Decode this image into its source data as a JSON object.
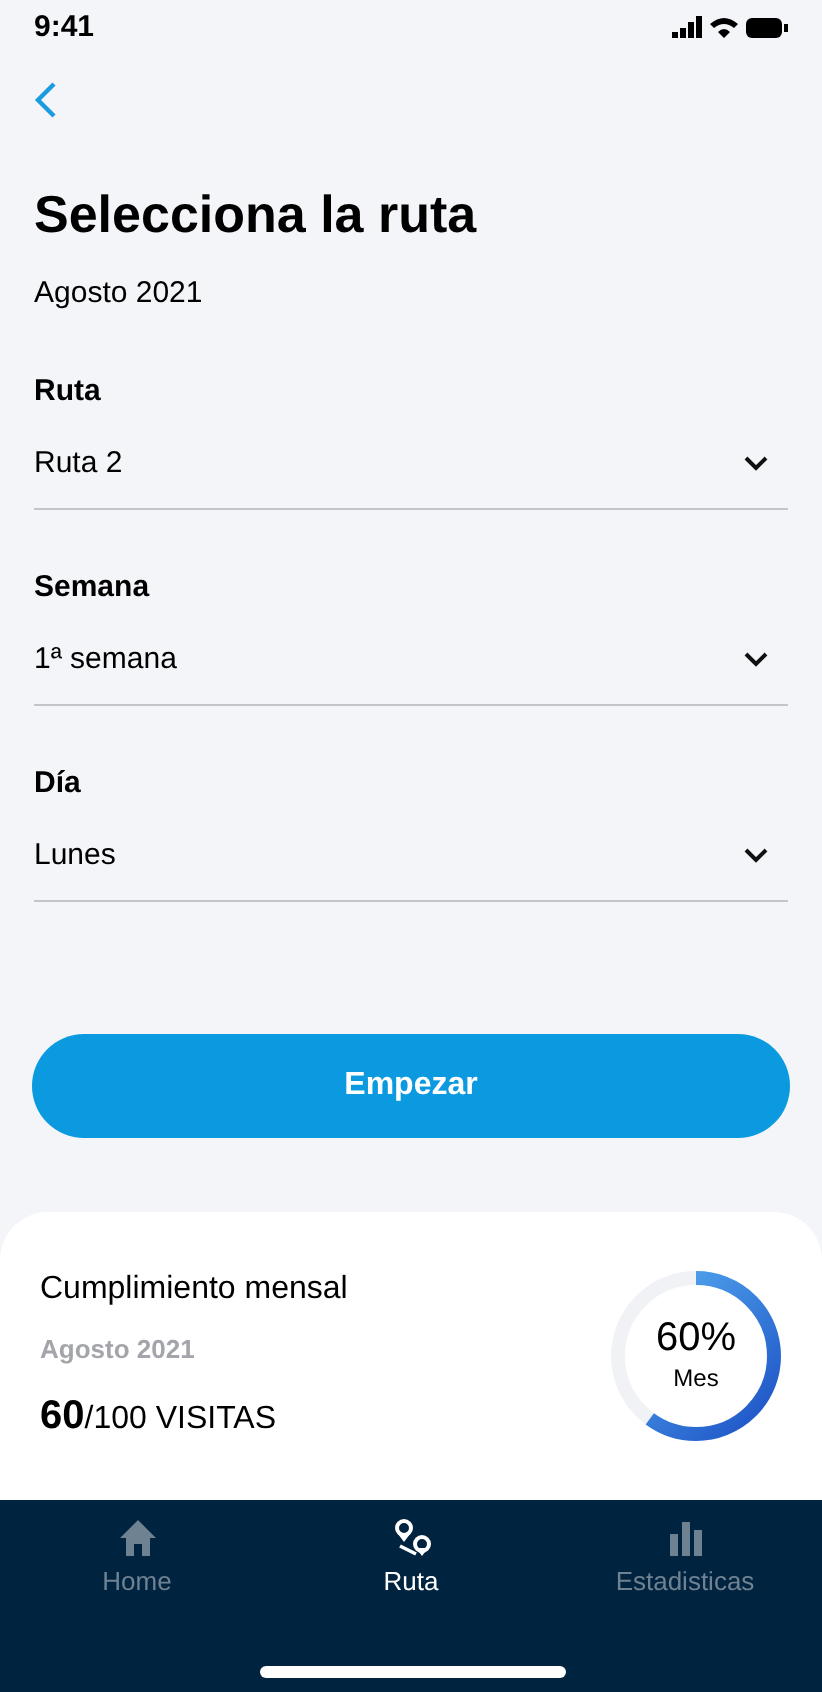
{
  "status_bar": {
    "time": "9:41"
  },
  "title": "Selecciona la ruta",
  "subtitle": "Agosto 2021",
  "fields": [
    {
      "label": "Ruta",
      "value": "Ruta 2"
    },
    {
      "label": "Semana",
      "value": "1ª semana"
    },
    {
      "label": "Día",
      "value": "Lunes"
    }
  ],
  "start_button": "Empezar",
  "summary": {
    "title": "Cumplimiento mensal",
    "period": "Agosto 2021",
    "done": "60",
    "total": "/100 VISITAS",
    "percent": "60%",
    "percent_caption": "Mes"
  },
  "tab_bar": [
    {
      "kind": "home",
      "label": "Home",
      "selected": false
    },
    {
      "kind": "route",
      "label": "Ruta",
      "selected": true
    },
    {
      "kind": "stats",
      "label": "Estadisticas",
      "selected": false
    }
  ]
}
